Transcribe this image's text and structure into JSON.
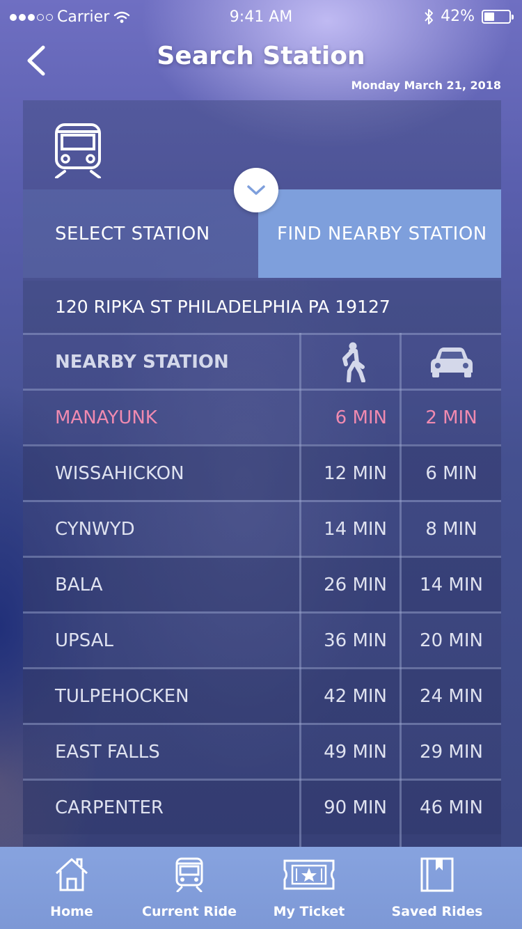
{
  "status_bar": {
    "carrier": "Carrier",
    "time": "9:41 AM",
    "battery": "42%",
    "battery_level": 0.42
  },
  "header": {
    "title": "Search Station",
    "date": "Monday March 21, 2018"
  },
  "tabs": {
    "select": "SELECT STATION",
    "find": "FIND NEARBY STATION"
  },
  "address": "120 RIPKA ST PHILADELPHIA PA 19127",
  "table": {
    "header": "NEARBY STATION",
    "rows": [
      {
        "station": "MANAYUNK",
        "walk": "6 MIN",
        "drive": "2 MIN"
      },
      {
        "station": "WISSAHICKON",
        "walk": "12 MIN",
        "drive": "6 MIN"
      },
      {
        "station": "CYNWYD",
        "walk": "14 MIN",
        "drive": "8 MIN"
      },
      {
        "station": "BALA",
        "walk": "26 MIN",
        "drive": "14 MIN"
      },
      {
        "station": "UPSAL",
        "walk": "36 MIN",
        "drive": "20 MIN"
      },
      {
        "station": "TULPEHOCKEN",
        "walk": "42 MIN",
        "drive": "24 MIN"
      },
      {
        "station": "EAST FALLS",
        "walk": "49 MIN",
        "drive": "29 MIN"
      },
      {
        "station": "CARPENTER",
        "walk": "90 MIN",
        "drive": "46 MIN"
      }
    ]
  },
  "nav": {
    "home": "Home",
    "current_ride": "Current Ride",
    "my_ticket": "My Ticket",
    "saved_rides": "Saved Rides"
  },
  "colors": {
    "highlight": "#f08ab0",
    "accent": "#7e9fdc",
    "tabbar": "#87a3df"
  }
}
